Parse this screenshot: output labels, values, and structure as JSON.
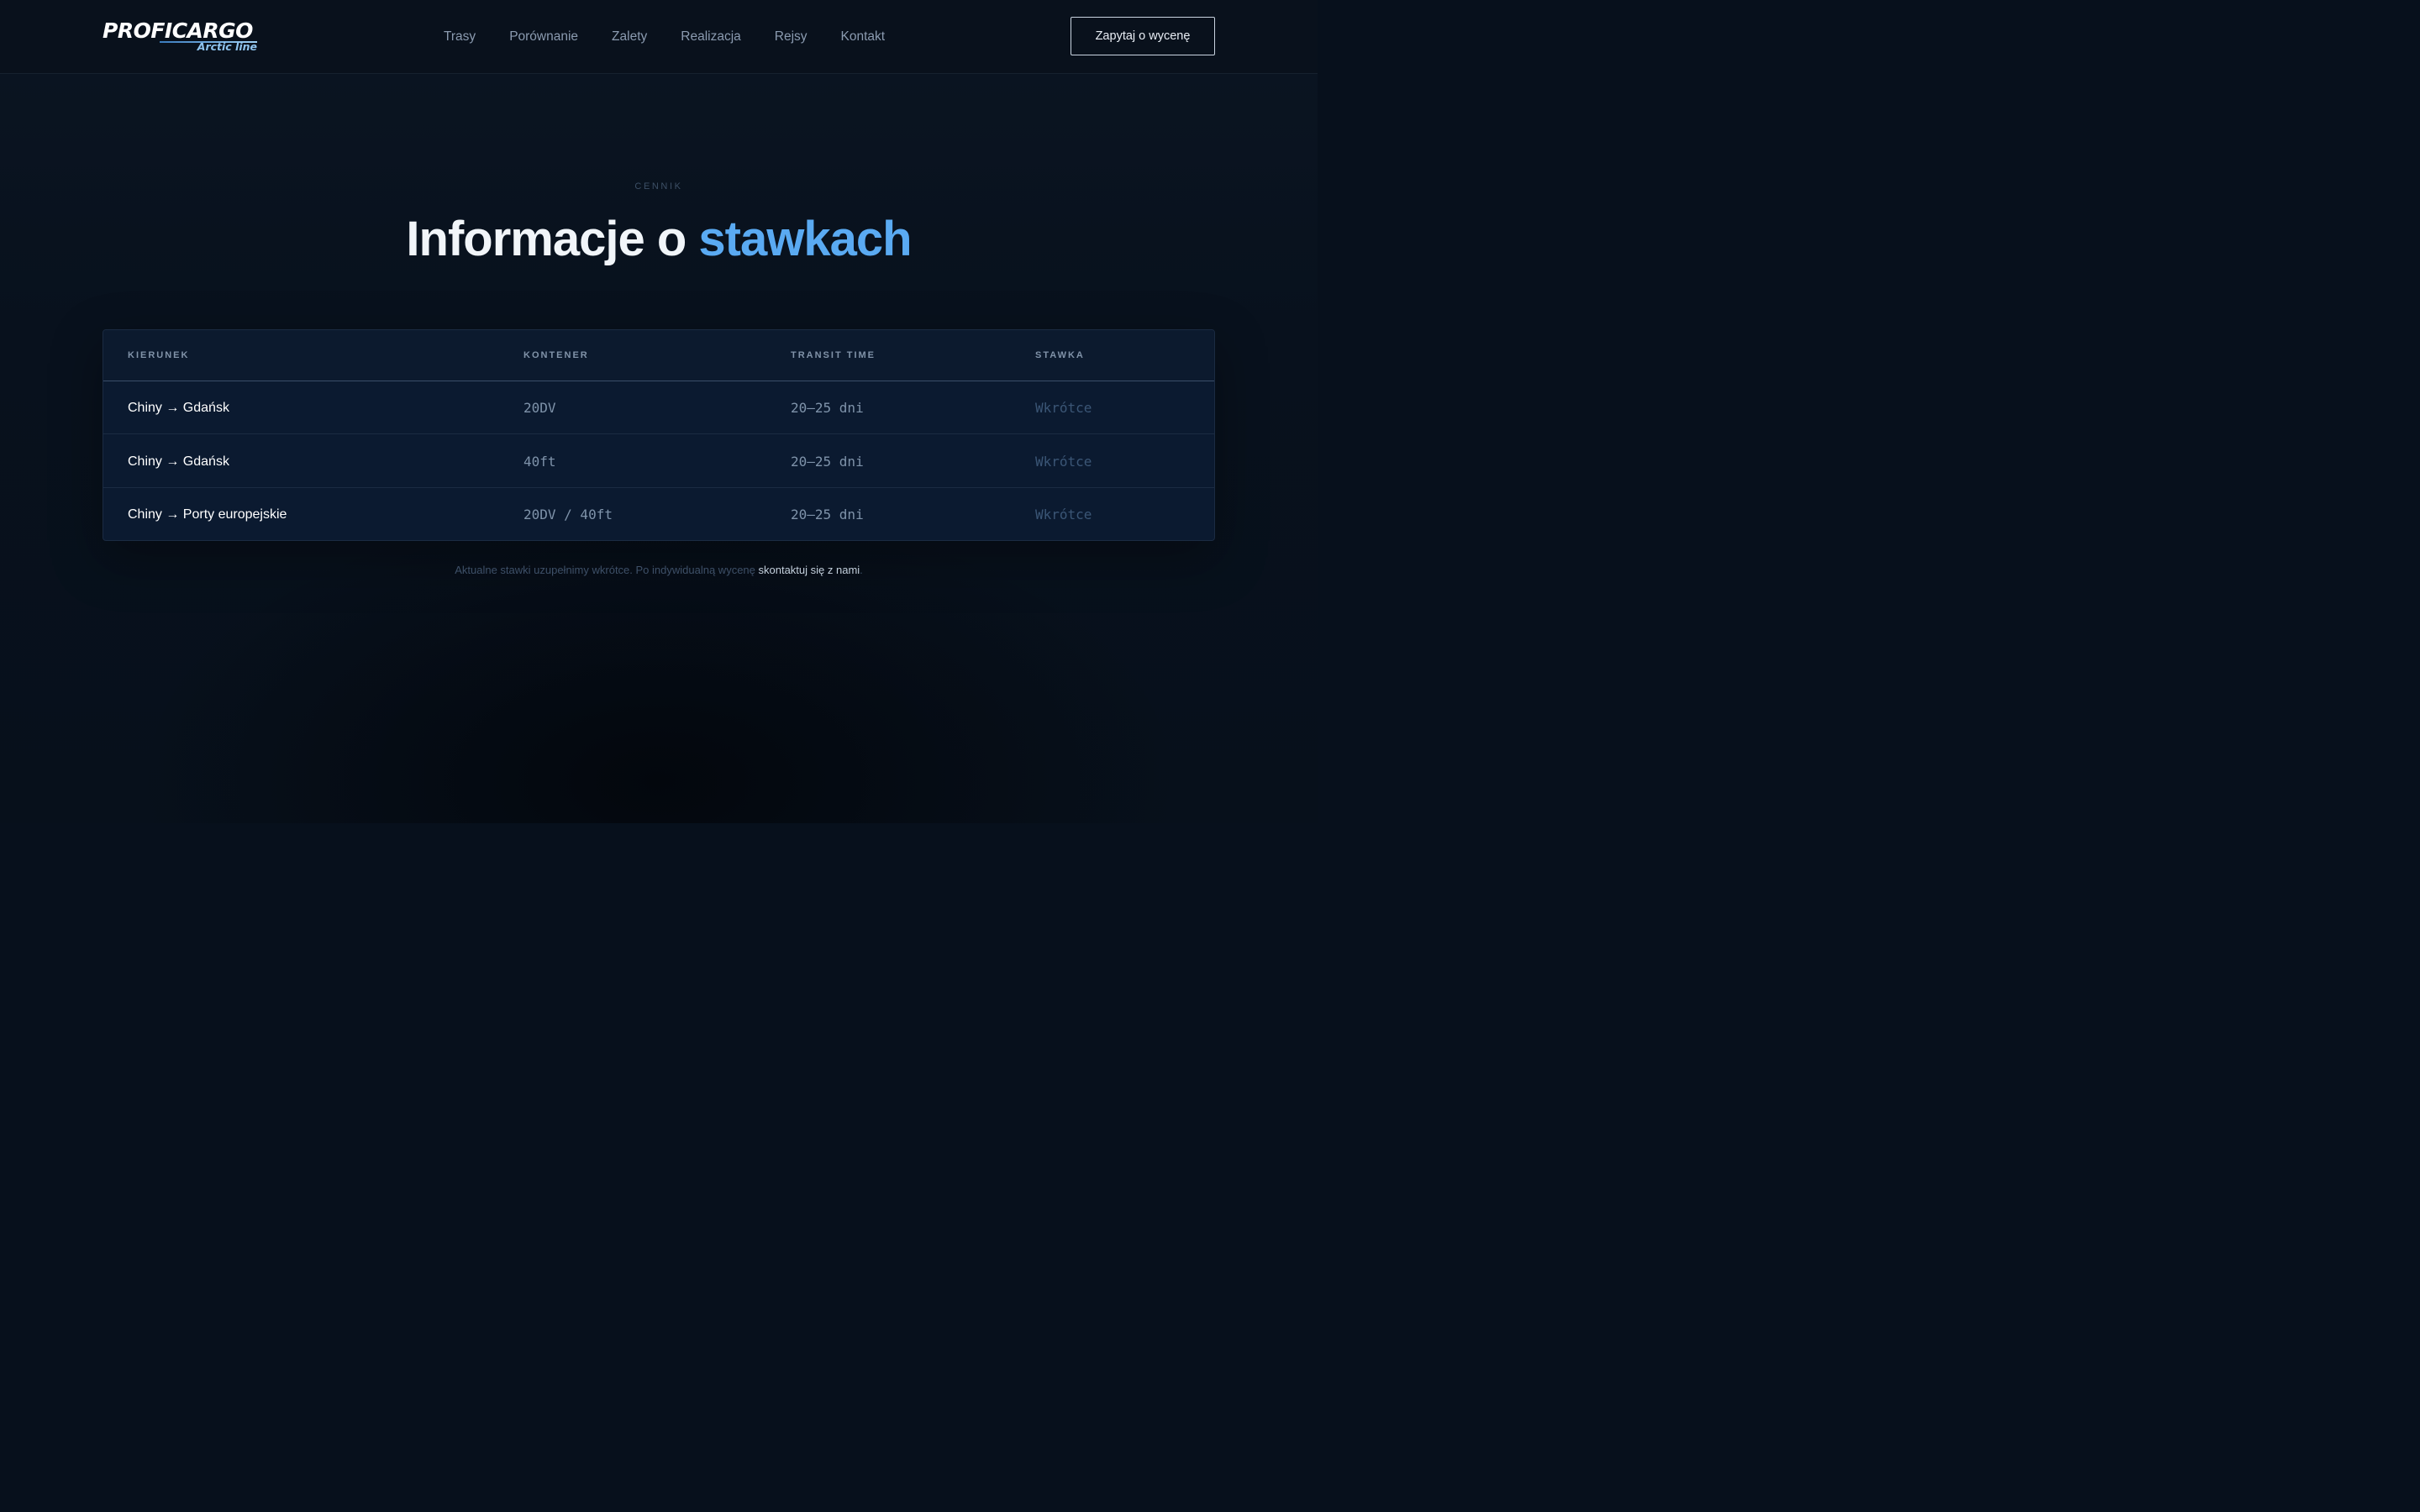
{
  "brand": {
    "name": "PROFICARGO",
    "sub": "Arctic line"
  },
  "nav": {
    "items": [
      "Trasy",
      "Porównanie",
      "Zalety",
      "Realizacja",
      "Rejsy",
      "Kontakt"
    ],
    "cta": "Zapytaj o wycenę"
  },
  "section": {
    "eyebrow": "CENNIK",
    "title_main": "Informacje o ",
    "title_accent": "stawkach"
  },
  "table": {
    "columns": [
      "KIERUNEK",
      "KONTENER",
      "TRANSIT TIME",
      "STAWKA"
    ],
    "rows": [
      {
        "direction": "Chiny → Gdańsk",
        "container": "20DV",
        "transit": "20–25 dni",
        "rate": "Wkrótce"
      },
      {
        "direction": "Chiny → Gdańsk",
        "container": "40ft",
        "transit": "20–25 dni",
        "rate": "Wkrótce"
      },
      {
        "direction": "Chiny → Porty europejskie",
        "container": "20DV / 40ft",
        "transit": "20–25 dni",
        "rate": "Wkrótce"
      }
    ]
  },
  "footnote": {
    "text": "Aktualne stawki uzupełnimy wkrótce. Po indywidualną wycenę ",
    "link": "skontaktuj się z nami",
    "end": "."
  },
  "colors": {
    "accent": "#5aaaf2",
    "background": "#07101c",
    "table_bg": "#0b1a30"
  }
}
